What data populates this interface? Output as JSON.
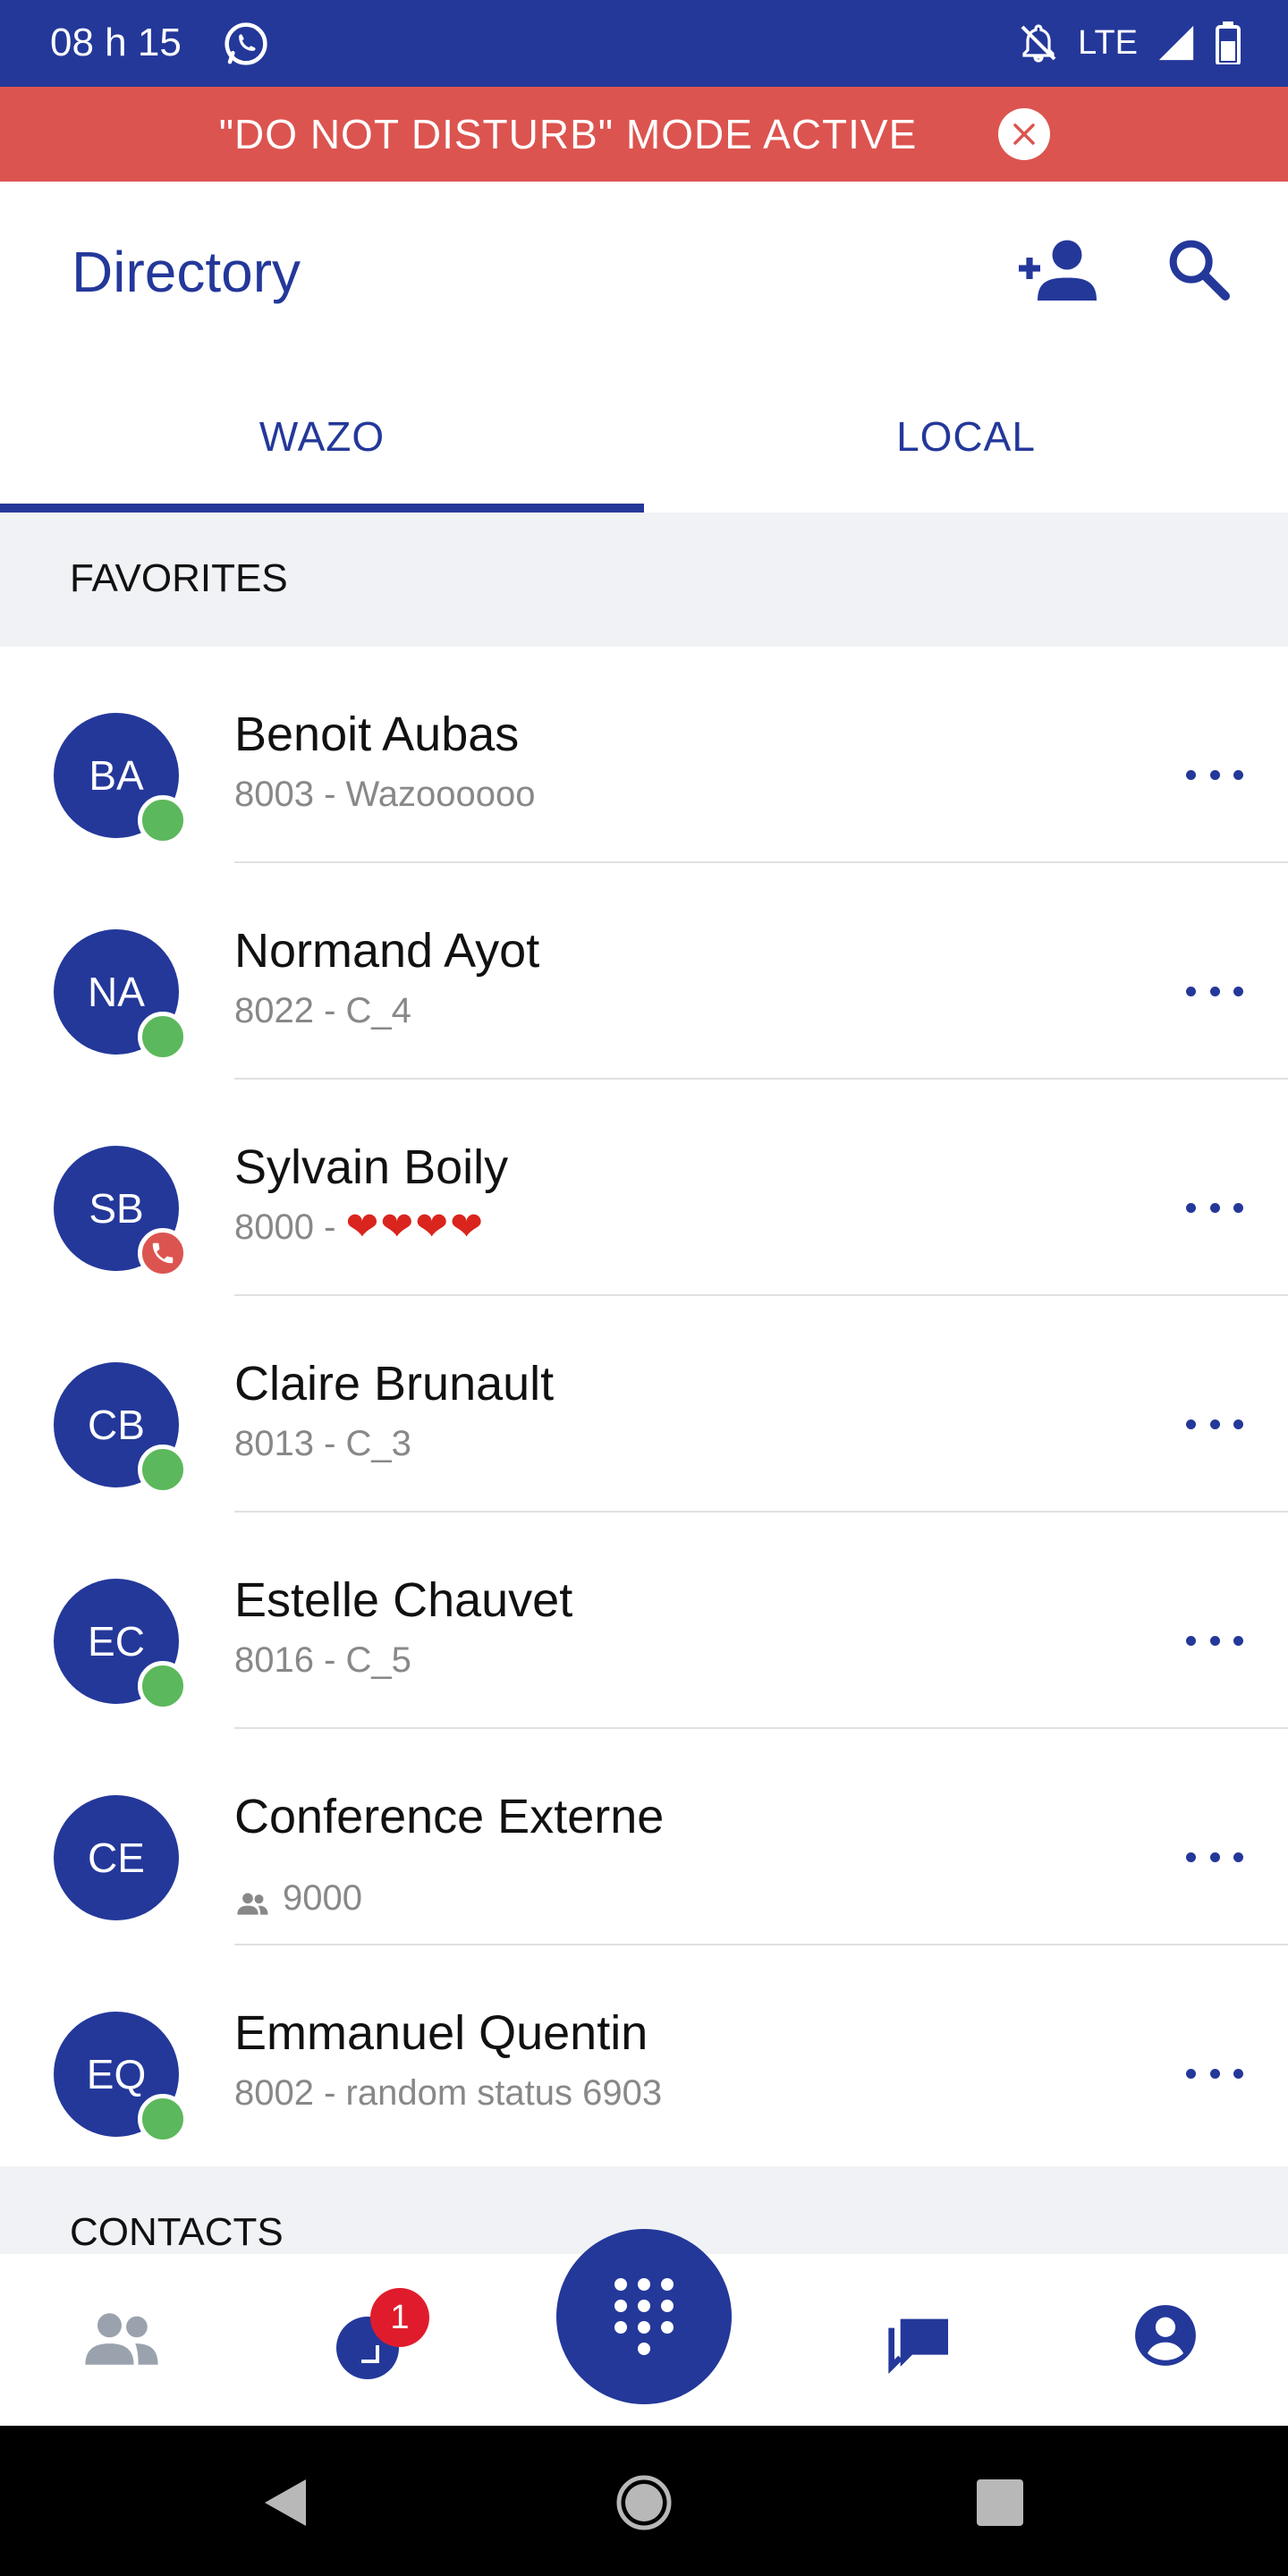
{
  "status_bar": {
    "time": "08 h 15",
    "network": "LTE"
  },
  "dnd_banner": {
    "text": "\"DO NOT DISTURB\" MODE ACTIVE"
  },
  "header": {
    "title": "Directory"
  },
  "tabs": [
    {
      "label": "WAZO",
      "active": true
    },
    {
      "label": "LOCAL",
      "active": false
    }
  ],
  "sections": {
    "favorites": "FAVORITES",
    "contacts": "CONTACTS"
  },
  "favorites": [
    {
      "initials": "BA",
      "name": "Benoit Aubas",
      "status": "8003 - Wazoooooo",
      "presence": "available"
    },
    {
      "initials": "NA",
      "name": "Normand Ayot",
      "status": "8022 - C_4",
      "presence": "available"
    },
    {
      "initials": "SB",
      "name": "Sylvain Boily",
      "status_prefix": "8000 - ",
      "status_hearts": "❤❤❤❤",
      "presence": "on-call"
    },
    {
      "initials": "CB",
      "name": "Claire Brunault",
      "status": "8013 - C_3",
      "presence": "available"
    },
    {
      "initials": "EC",
      "name": "Estelle Chauvet",
      "status": "8016 - C_5",
      "presence": "available"
    },
    {
      "initials": "CE",
      "name": "Conference Externe",
      "status": "9000",
      "presence": "conference"
    },
    {
      "initials": "EQ",
      "name": "Emmanuel Quentin",
      "status": "8002 - random status 6903",
      "presence": "available"
    }
  ],
  "bottom_nav": {
    "calls_badge": "1"
  },
  "colors": {
    "brand": "#24389a",
    "dnd": "#dc5450",
    "available": "#5cb85c",
    "badge": "#e01c2c"
  },
  "icons": {
    "status_bar": [
      "whatsapp-icon",
      "notifications-off-icon",
      "signal-icon",
      "battery-icon"
    ],
    "header": [
      "add-contact-icon",
      "search-icon"
    ],
    "bottom_nav": [
      "contacts-icon",
      "calls-icon",
      "dialpad-icon",
      "chat-icon",
      "profile-icon"
    ],
    "system_nav": [
      "back-icon",
      "home-icon",
      "recent-apps-icon"
    ]
  }
}
